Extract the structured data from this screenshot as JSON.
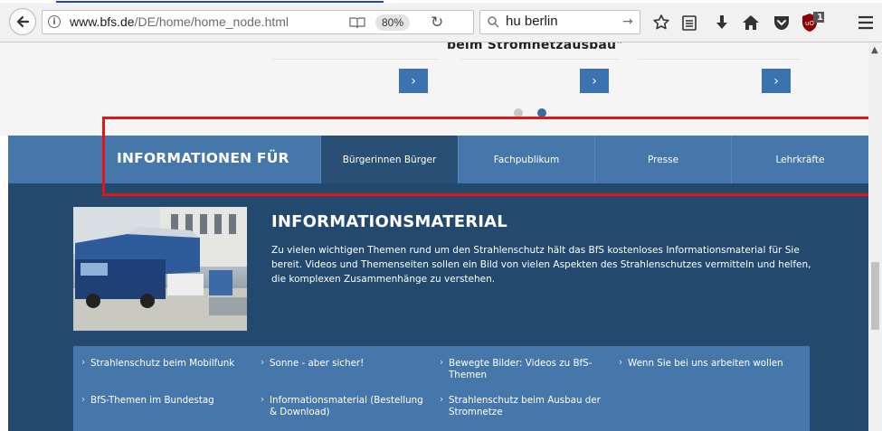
{
  "browser": {
    "url_domain": "www.bfs.de",
    "url_path": "/DE/home/home_node.html",
    "zoom": "80%",
    "search_value": "hu berlin",
    "addon_badge": "1"
  },
  "carousel": {
    "title": "beim Stromnetzausbau\"",
    "arrow_glyph": "›"
  },
  "info_bar": {
    "heading": "INFORMATIONEN FÜR",
    "tabs": [
      {
        "label": "Bürgerinnen Bürger",
        "active": true
      },
      {
        "label": "Fachpublikum",
        "active": false
      },
      {
        "label": "Presse",
        "active": false
      },
      {
        "label": "Lehrkräfte",
        "active": false
      }
    ]
  },
  "content": {
    "title": "INFORMATIONSMATERIAL",
    "text": "Zu vielen wichtigen Themen rund um den Strahlenschutz hält das BfS kostenloses Informationsmaterial für Sie bereit. Videos und Themenseiten sollen ein Bild von vielen Aspekten des Strahlenschutzes vermitteln und helfen, die komplexen Zusammenhänge zu verstehen.",
    "links": [
      "Strahlenschutz beim Mobilfunk",
      "Sonne - aber sicher!",
      "Bewegte Bilder: Videos zu BfS-Themen",
      "Wenn Sie bei uns arbeiten wollen",
      "BfS-Themen im Bundestag",
      "Informationsmaterial (Bestellung & Download)",
      "Strahlenschutz beim Ausbau der Stromnetze"
    ]
  },
  "colors": {
    "accent_blue": "#4677ab",
    "dark_blue": "#234a6e",
    "active_tab": "#294f75",
    "highlight_red": "#e81313"
  }
}
